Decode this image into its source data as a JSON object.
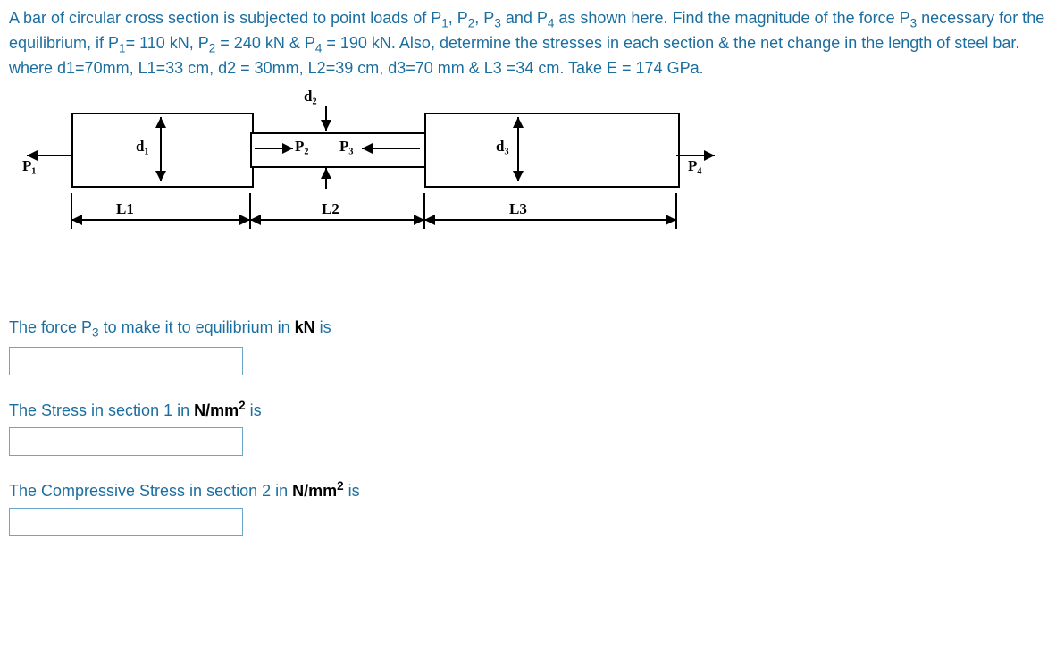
{
  "problem": {
    "sentence1_a": "A bar of circular cross section is subjected to point loads of P",
    "sentence1_b": " as shown here.  Find the magnitude of the force P",
    "sentence1_c": " necessary for the equilibrium, if P",
    "eq1": "= 110 kN, P",
    "eq2": " = 240 kN & P",
    "eq3": " = 190 kN.   Also, determine the stresses in each section & the net change in the length of steel bar.  where d1=70mm, L1=33 cm, d2 = 30mm, L2=39 cm, d3=70 mm & L3 =34 cm.   Take E = 174 GPa."
  },
  "diagram": {
    "d1": "d₁",
    "d2": "d₂",
    "d3": "d₃",
    "P1": "P₁",
    "P2": "P₂",
    "P3": "P₃",
    "P4": "P₄",
    "L1": "L1",
    "L2": "L2",
    "L3": "L3"
  },
  "questions": {
    "q1_a": "The force P",
    "q1_b": " to make it to equilibrium in ",
    "q1_unit": "kN",
    "q1_c": " is",
    "q2_a": "The Stress in section 1 in ",
    "q2_unit": "N/mm",
    "q2_b": " is",
    "q3_a": "The Compressive Stress in section 2 in ",
    "q3_unit": "N/mm",
    "q3_b": " is"
  }
}
